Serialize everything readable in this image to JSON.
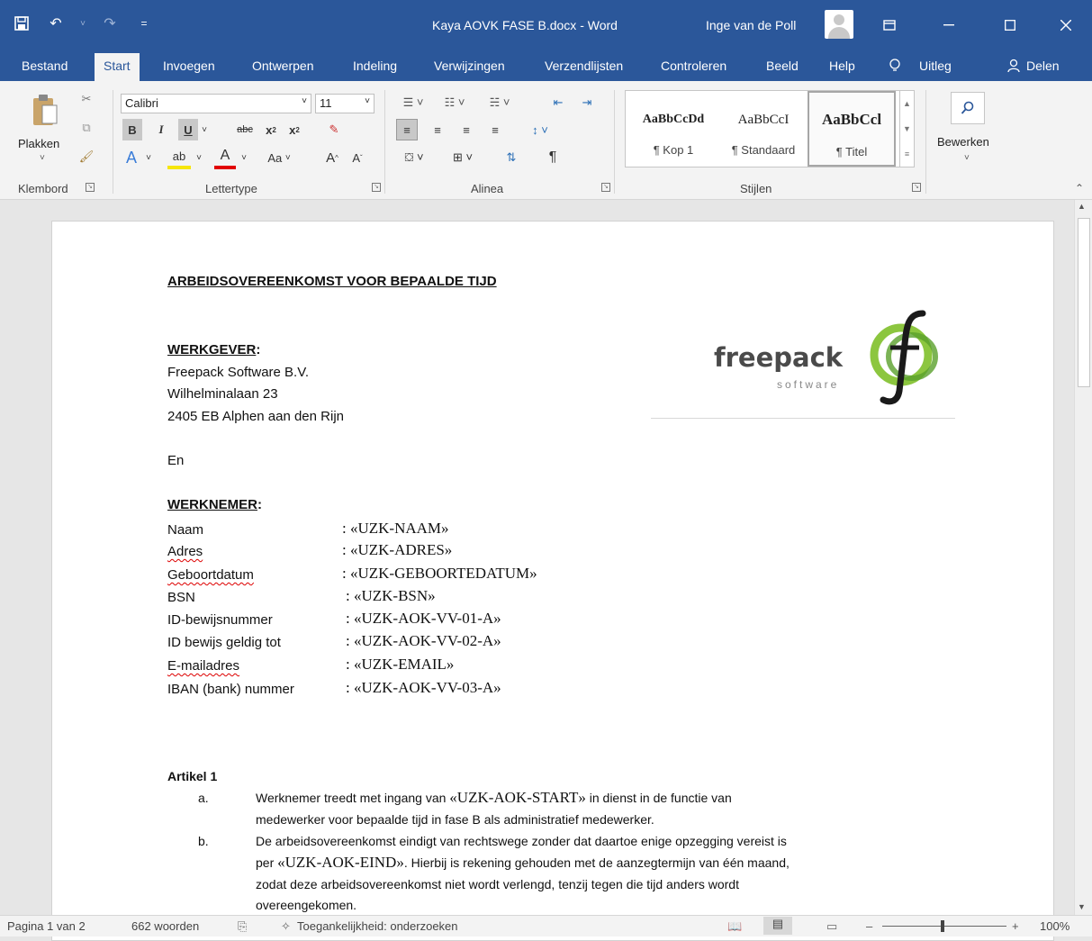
{
  "window": {
    "title": "Kaya AOVK FASE B.docx  -  Word",
    "user": "Inge van de Poll",
    "accent": "#2b579a"
  },
  "tabs": [
    "Bestand",
    "Start",
    "Invoegen",
    "Ontwerpen",
    "Indeling",
    "Verwijzingen",
    "Verzendlijsten",
    "Controleren",
    "Beeld",
    "Help",
    "Uitleg",
    "Delen"
  ],
  "ribbon": {
    "paste_label": "Plakken",
    "font_name": "Calibri",
    "font_size": "11",
    "case_label": "Aa",
    "styles": [
      {
        "preview": "AaBbCcDd",
        "name": "¶ Kop 1"
      },
      {
        "preview": "AaBbCcI",
        "name": "¶ Standaard"
      },
      {
        "preview": "AaBbCcl",
        "name": "¶ Titel"
      }
    ],
    "edit_label": "Bewerken",
    "groups": {
      "clipboard": "Klembord",
      "font": "Lettertype",
      "paragraph": "Alinea",
      "styles": "Stijlen"
    }
  },
  "document": {
    "heading": "ARBEIDSOVEREENKOMST VOOR  BEPAALDE TIJD",
    "logo": {
      "word": "freepack",
      "sub": "software"
    },
    "employer_title": "WERKGEVER",
    "employer_lines": [
      "Freepack Software B.V.",
      "Wilhelminalaan 23",
      "2405 EB Alphen aan den Rijn"
    ],
    "and": "En",
    "employee_title": "WERKNEMER",
    "fields": [
      {
        "label": "Naam",
        "value": ": «UZK-NAAM»"
      },
      {
        "label": "Adres",
        "value": ": «UZK-ADRES»"
      },
      {
        "label": "Geboortdatum",
        "value": ": «UZK-GEBOORTEDATUM»"
      },
      {
        "label": "BSN",
        "value": ": «UZK-BSN»"
      },
      {
        "label": "ID-bewijsnummer",
        "value": ": «UZK-AOK-VV-01-A»"
      },
      {
        "label": "ID bewijs geldig tot",
        "value": ": «UZK-AOK-VV-02-A»"
      },
      {
        "label": "E-mailadres",
        "value": ": «UZK-EMAIL»"
      },
      {
        "label": "IBAN (bank) nummer",
        "value": ": «UZK-AOK-VV-03-A»"
      }
    ],
    "article_title": "Artikel 1",
    "article_a_mark": "a.",
    "article_a_1_pre": "Werknemer treedt met ingang van ",
    "article_a_1_field": "«UZK-AOK-START»",
    "article_a_1_post": " in dienst in de functie van",
    "article_a_2": "medewerker voor bepaalde tijd in fase B als administratief medewerker.",
    "article_b_mark": "b.",
    "article_b_1": "De arbeidsovereenkomst eindigt van rechtswege zonder dat daartoe enige opzegging vereist is",
    "article_b_2_pre": "per ",
    "article_b_2_field": "«UZK-AOK-EIND»",
    "article_b_2_post": ". Hierbij is rekening gehouden met de aanzegtermijn van één maand,",
    "article_b_3": "zodat deze arbeidsovereenkomst niet wordt verlengd, tenzij tegen die tijd anders wordt",
    "article_b_4": "overeengekomen."
  },
  "status": {
    "page": "Pagina 1 van 2",
    "words": "662 woorden",
    "accessibility": "Toegankelijkheid: onderzoeken",
    "zoom": "100%"
  },
  "icons": [
    "save-icon",
    "undo-icon",
    "redo-icon",
    "customize-icon",
    "avatar",
    "ribbon-display-icon",
    "minimize-icon",
    "maximize-icon",
    "close-icon",
    "lightbulb-icon",
    "share-icon",
    "paste-icon",
    "cut-icon",
    "copy-icon",
    "format-painter-icon",
    "search-icon"
  ]
}
